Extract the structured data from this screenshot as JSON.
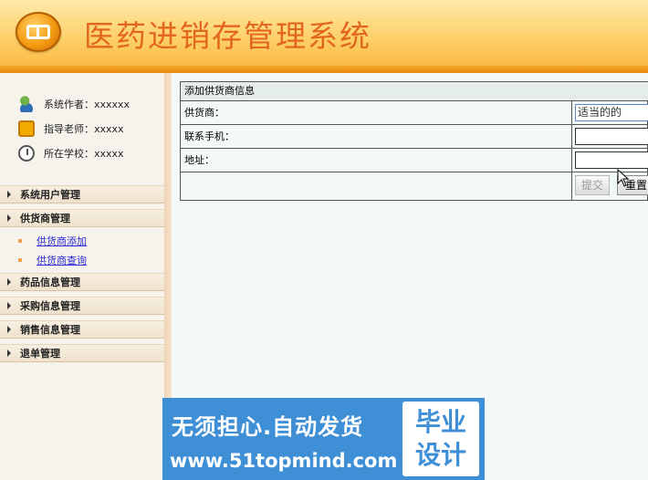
{
  "header": {
    "title": "医药进销存管理系统"
  },
  "sidebar": {
    "info": [
      {
        "label": "系统作者：xxxxxx",
        "icon": "user-group-icon"
      },
      {
        "label": "指导老师：xxxxx",
        "icon": "phone-icon"
      },
      {
        "label": "所在学校：xxxxx",
        "icon": "clock-icon"
      }
    ],
    "menu": {
      "users": "系统用户管理",
      "suppliers": "供货商管理",
      "supplier_add": "供货商添加",
      "supplier_query": "供货商查询",
      "drugs": "药品信息管理",
      "purchase": "采购信息管理",
      "sales": "销售信息管理",
      "returns": "退单管理"
    }
  },
  "form": {
    "title": "添加供货商信息",
    "supplier_label": "供货商：",
    "supplier_value": "适当的的",
    "phone_label": "联系手机：",
    "phone_value": "",
    "address_label": "地址：",
    "address_value": "",
    "submit_label": "提交",
    "reset_label": "重置"
  },
  "watermark": {
    "line1": "无须担心.自动发货",
    "line2": "www.51topmind.com",
    "badge_top": "毕业",
    "badge_bottom": "设计"
  },
  "colors": {
    "header_title": "#e2661e",
    "link": "#2a2bd1",
    "watermark_bg": "#3f8fd7"
  }
}
